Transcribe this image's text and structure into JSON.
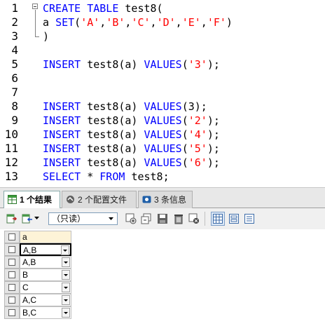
{
  "editor": {
    "line_numbers": [
      "1",
      "2",
      "3",
      "4",
      "5",
      "6",
      "7",
      "8",
      "9",
      "10",
      "11",
      "12",
      "13"
    ],
    "lines": [
      [
        {
          "t": "kw",
          "v": "CREATE TABLE "
        },
        {
          "t": "pl",
          "v": "test8("
        }
      ],
      [
        {
          "t": "pl",
          "v": "a "
        },
        {
          "t": "kw",
          "v": "SET"
        },
        {
          "t": "pl",
          "v": "("
        },
        {
          "t": "str",
          "v": "'A'"
        },
        {
          "t": "pl",
          "v": ","
        },
        {
          "t": "str",
          "v": "'B'"
        },
        {
          "t": "pl",
          "v": ","
        },
        {
          "t": "str",
          "v": "'C'"
        },
        {
          "t": "pl",
          "v": ","
        },
        {
          "t": "str",
          "v": "'D'"
        },
        {
          "t": "pl",
          "v": ","
        },
        {
          "t": "str",
          "v": "'E'"
        },
        {
          "t": "pl",
          "v": ","
        },
        {
          "t": "str",
          "v": "'F'"
        },
        {
          "t": "pl",
          "v": ")"
        }
      ],
      [
        {
          "t": "pl",
          "v": ")"
        }
      ],
      [],
      [
        {
          "t": "kw",
          "v": "INSERT "
        },
        {
          "t": "pl",
          "v": "test8(a) "
        },
        {
          "t": "kw",
          "v": "VALUES"
        },
        {
          "t": "pl",
          "v": "("
        },
        {
          "t": "str",
          "v": "'3'"
        },
        {
          "t": "pl",
          "v": ");"
        }
      ],
      [],
      [],
      [
        {
          "t": "kw",
          "v": "INSERT "
        },
        {
          "t": "pl",
          "v": "test8(a) "
        },
        {
          "t": "kw",
          "v": "VALUES"
        },
        {
          "t": "pl",
          "v": "(3);"
        }
      ],
      [
        {
          "t": "kw",
          "v": "INSERT "
        },
        {
          "t": "pl",
          "v": "test8(a) "
        },
        {
          "t": "kw",
          "v": "VALUES"
        },
        {
          "t": "pl",
          "v": "("
        },
        {
          "t": "str",
          "v": "'2'"
        },
        {
          "t": "pl",
          "v": ");"
        }
      ],
      [
        {
          "t": "kw",
          "v": "INSERT "
        },
        {
          "t": "pl",
          "v": "test8(a) "
        },
        {
          "t": "kw",
          "v": "VALUES"
        },
        {
          "t": "pl",
          "v": "("
        },
        {
          "t": "str",
          "v": "'4'"
        },
        {
          "t": "pl",
          "v": ");"
        }
      ],
      [
        {
          "t": "kw",
          "v": "INSERT "
        },
        {
          "t": "pl",
          "v": "test8(a) "
        },
        {
          "t": "kw",
          "v": "VALUES"
        },
        {
          "t": "pl",
          "v": "("
        },
        {
          "t": "str",
          "v": "'5'"
        },
        {
          "t": "pl",
          "v": ");"
        }
      ],
      [
        {
          "t": "kw",
          "v": "INSERT "
        },
        {
          "t": "pl",
          "v": "test8(a) "
        },
        {
          "t": "kw",
          "v": "VALUES"
        },
        {
          "t": "pl",
          "v": "("
        },
        {
          "t": "str",
          "v": "'6'"
        },
        {
          "t": "pl",
          "v": ");"
        }
      ],
      [
        {
          "t": "kw",
          "v": "SELECT "
        },
        {
          "t": "pl",
          "v": "* "
        },
        {
          "t": "kw",
          "v": "FROM "
        },
        {
          "t": "pl",
          "v": "test8;"
        }
      ]
    ]
  },
  "tabs": [
    {
      "label": "1 个结果",
      "icon": "result-grid-icon",
      "active": true
    },
    {
      "label": "2 个配置文件",
      "icon": "profile-icon",
      "active": false
    },
    {
      "label": "3 条信息",
      "icon": "info-icon",
      "active": false
    }
  ],
  "toolbar": {
    "mode_select": "（只读）",
    "icons": [
      "export-icon",
      "import-icon",
      "add-row-icon",
      "duplicate-row-icon",
      "save-icon",
      "delete-row-icon",
      "cancel-icon",
      "grid-view-icon",
      "form-view-icon",
      "text-view-icon"
    ]
  },
  "grid": {
    "column_header": "a",
    "rows": [
      "A,B",
      "A,B",
      "B",
      "C",
      "A,C",
      "B,C"
    ]
  },
  "colors": {
    "keyword": "#0000ff",
    "string": "#ff0000",
    "header_bg": "#fdf3d7"
  }
}
